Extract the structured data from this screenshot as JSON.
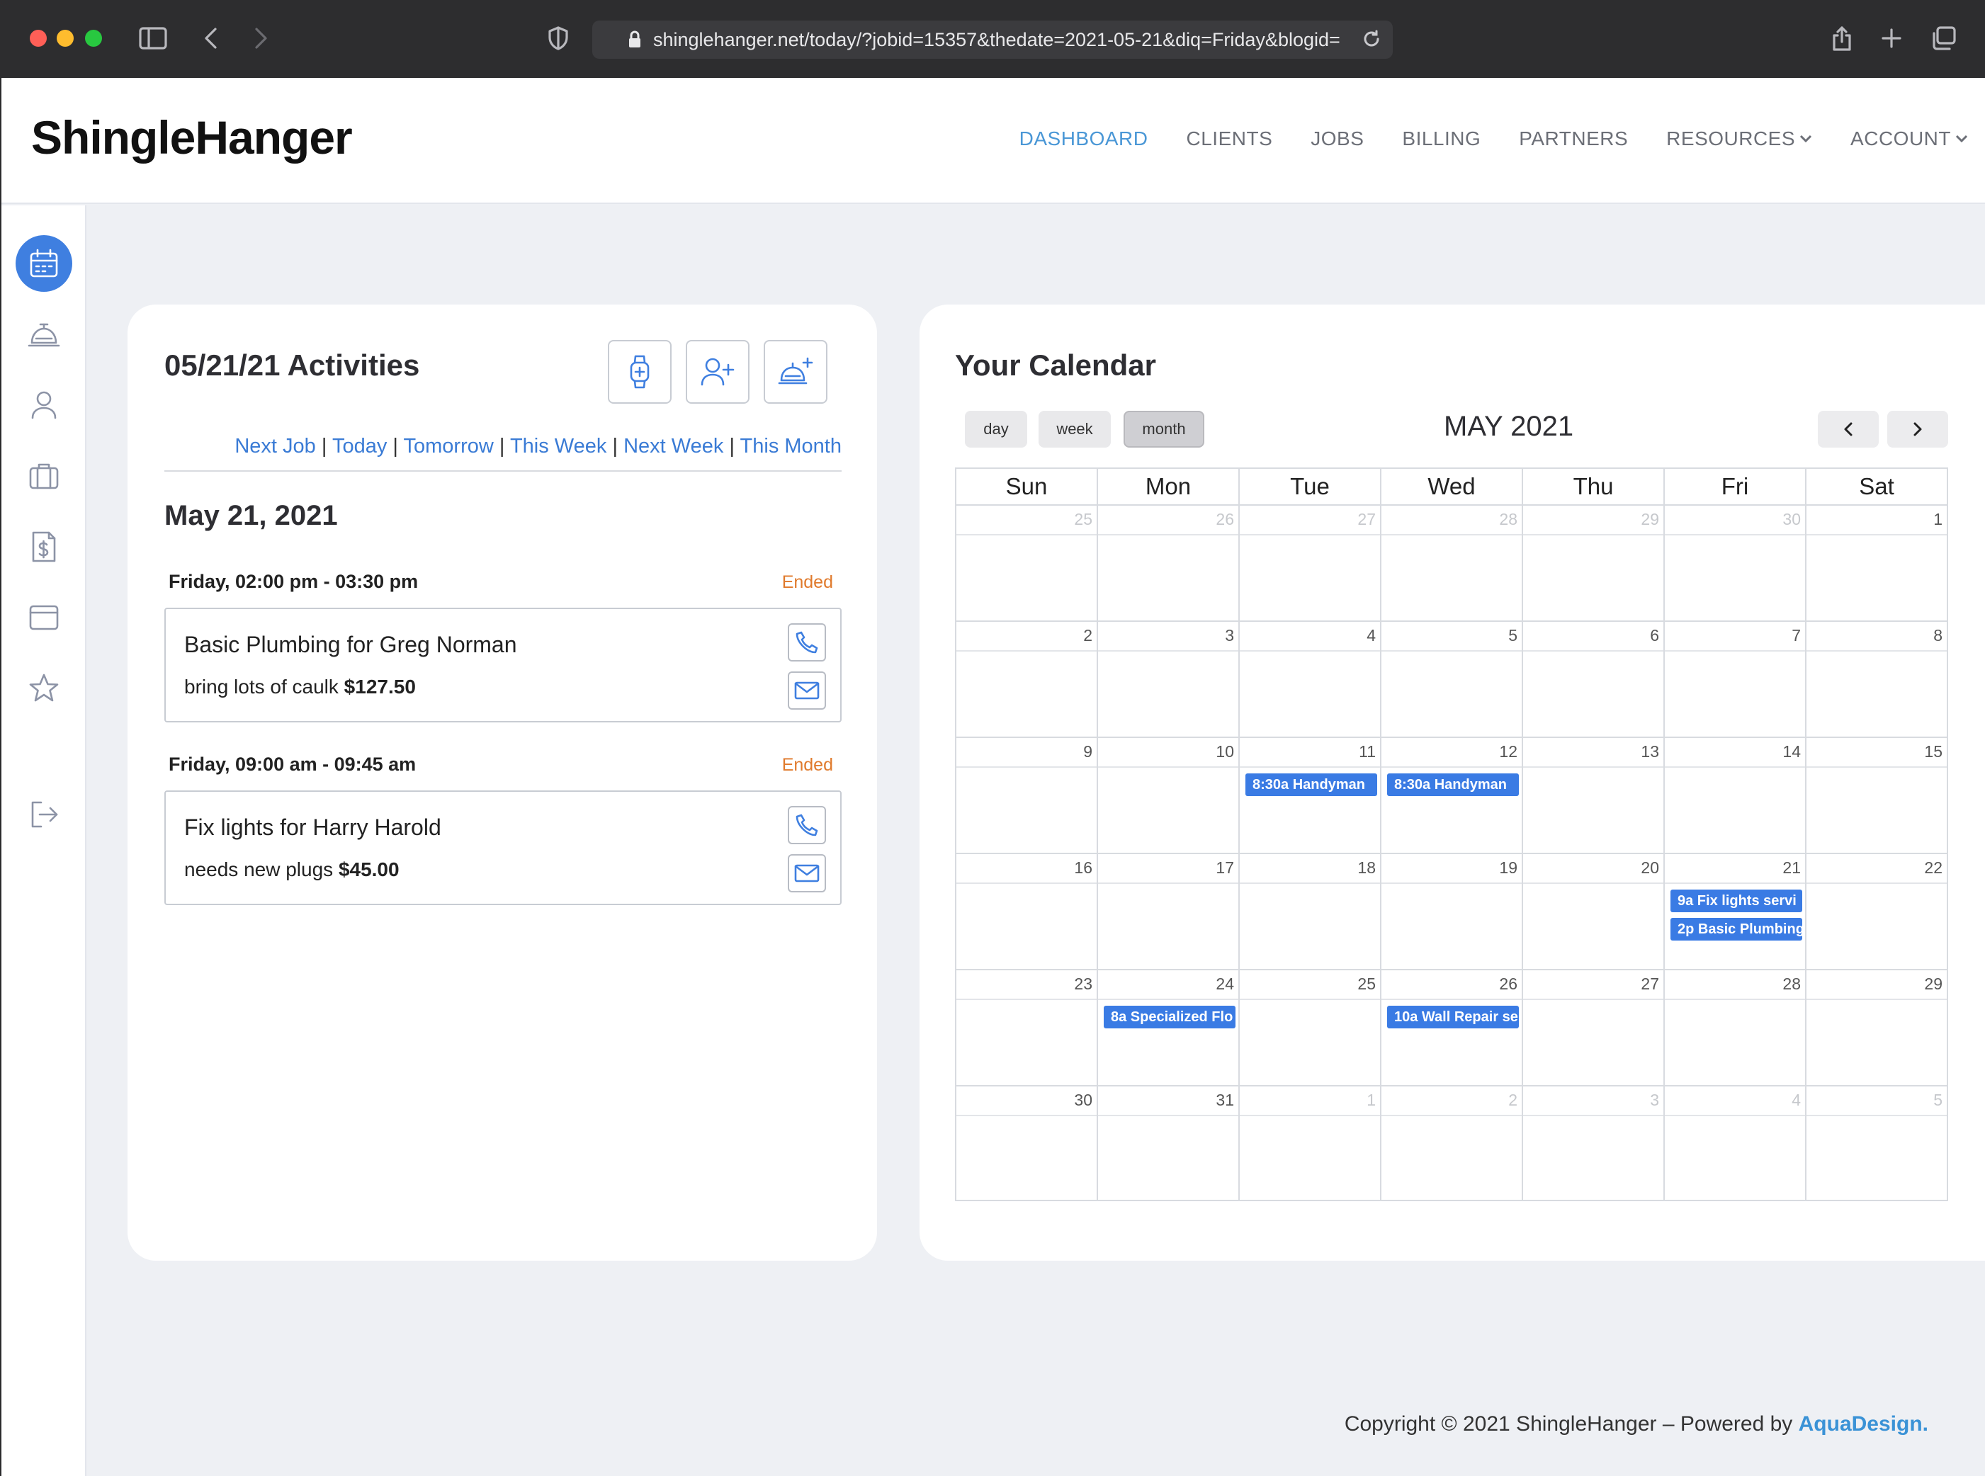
{
  "browser": {
    "url": "shinglehanger.net/today/?jobid=15357&thedate=2021-05-21&diq=Friday&blogid="
  },
  "app": {
    "logo": "ShingleHanger",
    "nav": {
      "dashboard": "DASHBOARD",
      "clients": "CLIENTS",
      "jobs": "JOBS",
      "billing": "BILLING",
      "partners": "PARTNERS",
      "resources": "RESOURCES",
      "account": "ACCOUNT"
    },
    "accent_color": "#3f7fe0"
  },
  "activities": {
    "title": "05/21/21 Activities",
    "links": {
      "next_job": "Next Job",
      "today": "Today",
      "tomorrow": "Tomorrow",
      "this_week": "This Week",
      "next_week": "Next Week",
      "this_month": "This Month",
      "sep": "|"
    },
    "date_heading": "May 21, 2021",
    "jobs": [
      {
        "time": "Friday, 02:00 pm - 03:30 pm",
        "status": "Ended",
        "title": "Basic Plumbing for Greg Norman",
        "note": "bring lots of caulk",
        "amount": "$127.50"
      },
      {
        "time": "Friday, 09:00 am - 09:45 am",
        "status": "Ended",
        "title": "Fix lights for Harry Harold",
        "note": "needs new plugs",
        "amount": "$45.00"
      }
    ]
  },
  "calendar": {
    "title": "Your Calendar",
    "views": {
      "day": "day",
      "week": "week",
      "month": "month"
    },
    "active_view": "month",
    "month_label": "MAY 2021",
    "days_of_week": [
      "Sun",
      "Mon",
      "Tue",
      "Wed",
      "Thu",
      "Fri",
      "Sat"
    ],
    "weeks": [
      [
        {
          "n": "25",
          "o": true
        },
        {
          "n": "26",
          "o": true
        },
        {
          "n": "27",
          "o": true
        },
        {
          "n": "28",
          "o": true
        },
        {
          "n": "29",
          "o": true
        },
        {
          "n": "30",
          "o": true
        },
        {
          "n": "1"
        }
      ],
      [
        {
          "n": "2"
        },
        {
          "n": "3"
        },
        {
          "n": "4"
        },
        {
          "n": "5"
        },
        {
          "n": "6"
        },
        {
          "n": "7"
        },
        {
          "n": "8"
        }
      ],
      [
        {
          "n": "9"
        },
        {
          "n": "10"
        },
        {
          "n": "11",
          "events": [
            "8:30a Handyman"
          ]
        },
        {
          "n": "12",
          "events": [
            "8:30a Handyman"
          ]
        },
        {
          "n": "13"
        },
        {
          "n": "14"
        },
        {
          "n": "15"
        }
      ],
      [
        {
          "n": "16"
        },
        {
          "n": "17"
        },
        {
          "n": "18"
        },
        {
          "n": "19"
        },
        {
          "n": "20"
        },
        {
          "n": "21",
          "events": [
            "9a Fix lights servi",
            "2p Basic Plumbing"
          ]
        },
        {
          "n": "22"
        }
      ],
      [
        {
          "n": "23"
        },
        {
          "n": "24",
          "events": [
            "8a Specialized Flo"
          ]
        },
        {
          "n": "25"
        },
        {
          "n": "26",
          "events": [
            "10a Wall Repair se"
          ]
        },
        {
          "n": "27"
        },
        {
          "n": "28"
        },
        {
          "n": "29"
        }
      ],
      [
        {
          "n": "30"
        },
        {
          "n": "31"
        },
        {
          "n": "1",
          "o": true
        },
        {
          "n": "2",
          "o": true
        },
        {
          "n": "3",
          "o": true
        },
        {
          "n": "4",
          "o": true
        },
        {
          "n": "5",
          "o": true
        }
      ]
    ],
    "event_color": "#3a7be4"
  },
  "footer": {
    "text": "Copyright © 2021 ShingleHanger – Powered by ",
    "link": "AquaDesign."
  }
}
